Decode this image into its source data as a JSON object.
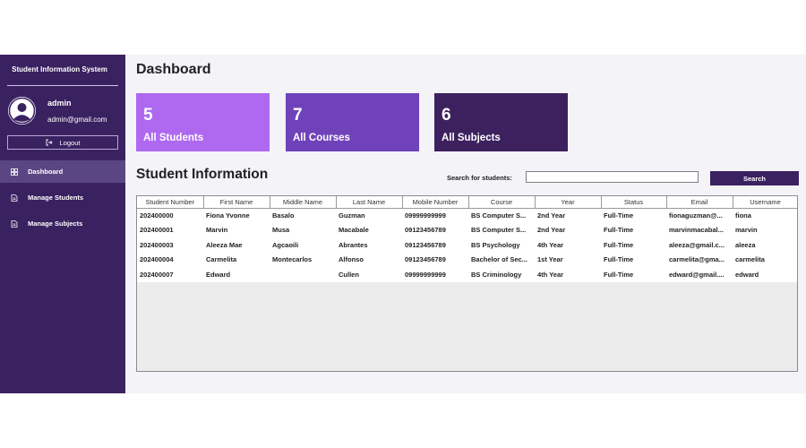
{
  "sidebar": {
    "title": "Student Information System",
    "user": {
      "name": "admin",
      "email": "admin@gmail.com"
    },
    "logout_label": "Logout",
    "nav": [
      {
        "label": "Dashboard",
        "icon": "dashboard-grid-icon",
        "active": true
      },
      {
        "label": "Manage Students",
        "icon": "document-icon",
        "active": false
      },
      {
        "label": "Manage Subjects",
        "icon": "document-icon",
        "active": false
      }
    ]
  },
  "main": {
    "title": "Dashboard",
    "cards": [
      {
        "value": "5",
        "label": "All Students",
        "color": "#ae69f0"
      },
      {
        "value": "7",
        "label": "All Courses",
        "color": "#7042ba"
      },
      {
        "value": "6",
        "label": "All Subjects",
        "color": "#3d215f"
      }
    ],
    "section_title": "Student Information",
    "search": {
      "label": "Search for students:",
      "value": "",
      "button_label": "Search"
    },
    "table": {
      "columns": [
        "Student Number",
        "First Name",
        "Middle Name",
        "Last Name",
        "Mobile Number",
        "Course",
        "Year",
        "Status",
        "Email",
        "Username"
      ],
      "rows": [
        [
          "202400000",
          "Fiona Yvonne",
          "Basalo",
          "Guzman",
          "09999999999",
          "BS Computer S...",
          "2nd Year",
          "Full-Time",
          "fionaguzman@...",
          "fiona"
        ],
        [
          "202400001",
          "Marvin",
          "Musa",
          "Macabale",
          "09123456789",
          "BS Computer S...",
          "2nd Year",
          "Full-Time",
          "marvinmacabal...",
          "marvin"
        ],
        [
          "202400003",
          "Aleeza Mae",
          "Agcaoili",
          "Abrantes",
          "09123456789",
          "BS Psychology",
          "4th Year",
          "Full-Time",
          "aleeza@gmail.c...",
          "aleeza"
        ],
        [
          "202400004",
          "Carmelita",
          "Montecarlos",
          "Alfonso",
          "09123456789",
          "Bachelor of Sec...",
          "1st Year",
          "Full-Time",
          "carmelita@gma...",
          "carmelita"
        ],
        [
          "202400007",
          "Edward",
          "",
          "Cullen",
          "09999999999",
          "BS Criminology",
          "4th Year",
          "Full-Time",
          "edward@gmail....",
          "edward"
        ]
      ]
    }
  },
  "colors": {
    "sidebar_bg": "#3a2160",
    "sidebar_active": "#5b4684",
    "content_bg": "#f3f3f8",
    "accent": "#3a2160"
  }
}
